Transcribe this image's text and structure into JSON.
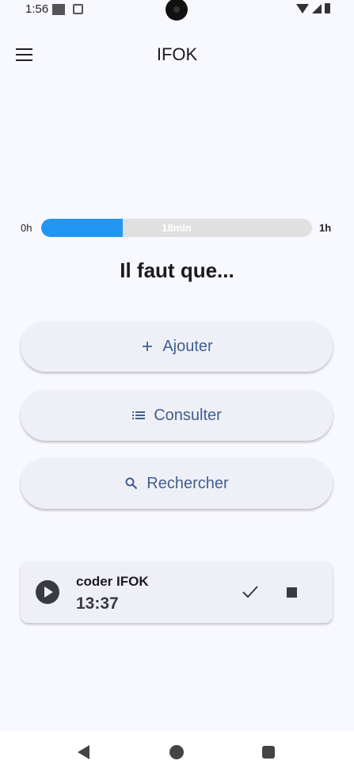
{
  "status_bar": {
    "time": "1:56"
  },
  "app_bar": {
    "title": "IFOK"
  },
  "progress": {
    "left_label": "0h",
    "right_label": "1h",
    "value_label": "18min",
    "fraction": 0.3,
    "fill_color": "#2196f3",
    "track_color": "#e0e0e0"
  },
  "heading": "Il faut que...",
  "actions": {
    "add_label": "Ajouter",
    "list_label": "Consulter",
    "search_label": "Rechercher"
  },
  "task": {
    "name": "coder IFOK",
    "time": "13:37"
  },
  "icons": {
    "menu": "menu-icon",
    "add": "plus-icon",
    "list": "list-icon",
    "search": "search-icon",
    "play": "play-icon",
    "check": "check-icon",
    "stop": "stop-icon"
  },
  "colors": {
    "accent": "#3f5f90",
    "background": "#f8f9fe",
    "button_bg": "#eff0f7"
  }
}
